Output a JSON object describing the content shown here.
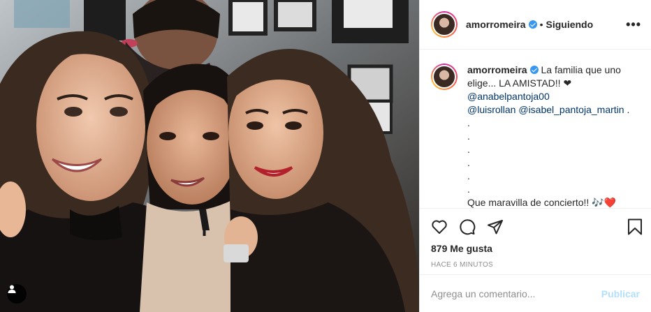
{
  "header": {
    "username": "amorromeira",
    "separator": "•",
    "follow_status": "Siguiendo",
    "more_label": "•••"
  },
  "caption": {
    "username": "amorromeira",
    "text_line1": "La familia que uno elige... LA AMISTAD!! ❤",
    "mention1": "@anabelpantoja00",
    "mention2": "@luisrollan",
    "mention3": "@isabel_pantoja_martin",
    "mention3_trailing": " .",
    "dots": [
      ".",
      ".",
      ".",
      ".",
      ".",
      "."
    ],
    "closing": "Que maravilla de concierto!! 🎶❤️"
  },
  "engagement": {
    "likes": "879 Me gusta",
    "timestamp": "HACE 6 MINUTOS"
  },
  "comment": {
    "placeholder": "Agrega un comentario...",
    "post_label": "Publicar"
  },
  "colors": {
    "verified": "#3897f0",
    "mention": "#003569",
    "post_button": "#b2dffc",
    "meta_text": "#8e8e8e"
  },
  "icons": [
    "user-tag-icon",
    "heart-icon",
    "comment-icon",
    "share-icon",
    "bookmark-icon",
    "more-options-icon",
    "verified-badge-icon"
  ]
}
